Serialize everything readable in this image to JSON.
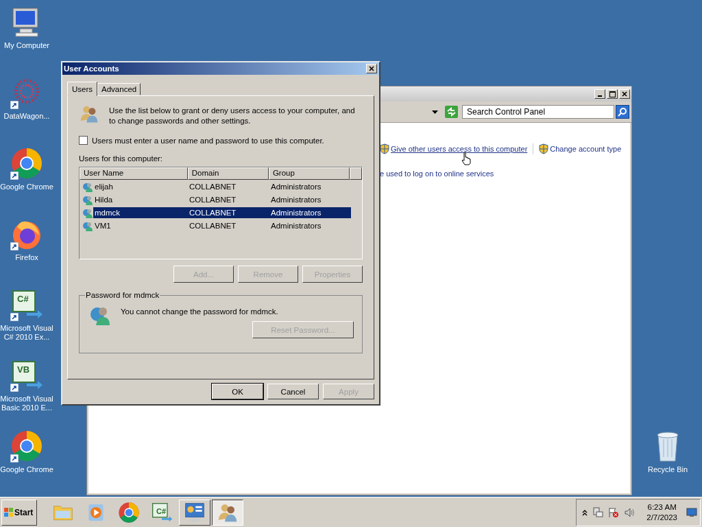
{
  "desktop_icons": [
    {
      "label": "My Computer",
      "kind": "computer",
      "shortcut": false
    },
    {
      "label": "DataWagon...",
      "kind": "dots",
      "shortcut": true
    },
    {
      "label": "Google Chrome",
      "kind": "chrome",
      "shortcut": true
    },
    {
      "label": "Firefox",
      "kind": "firefox",
      "shortcut": true
    },
    {
      "label": "Microsoft Visual C# 2010 Ex...",
      "kind": "studio",
      "badge": "C#",
      "shortcut": true
    },
    {
      "label": "Microsoft Visual Basic 2010 E...",
      "kind": "studio",
      "badge": "VB",
      "shortcut": true
    },
    {
      "label": "Google Chrome",
      "kind": "chrome",
      "shortcut": true
    }
  ],
  "recycle_bin": {
    "label": "Recycle Bin"
  },
  "control_panel": {
    "search": {
      "placeholder": "Search Control Panel"
    },
    "links": [
      {
        "label": "Give other users access to this computer",
        "hovered": true
      },
      {
        "label": "Change account type",
        "hovered": false
      }
    ],
    "partial_text": "e used to log on to online services"
  },
  "dialog": {
    "title": "User Accounts",
    "tabs": [
      {
        "label": "Users",
        "selected": true
      },
      {
        "label": "Advanced",
        "selected": false
      }
    ],
    "intro": "Use the list below to grant or deny users access to your computer, and to change passwords and other settings.",
    "require_password": {
      "label": "Users must enter a user name and password to use this computer.",
      "checked": false
    },
    "list_label": "Users for this computer:",
    "columns": [
      "User Name",
      "Domain",
      "Group"
    ],
    "rows": [
      {
        "cells": [
          "elijah",
          "COLLABNET",
          "Administrators"
        ],
        "selected": false
      },
      {
        "cells": [
          "Hilda",
          "COLLABNET",
          "Administrators"
        ],
        "selected": false
      },
      {
        "cells": [
          "mdmck",
          "COLLABNET",
          "Administrators"
        ],
        "selected": true
      },
      {
        "cells": [
          "VM1",
          "COLLABNET",
          "Administrators"
        ],
        "selected": false
      }
    ],
    "list_buttons": [
      {
        "label": "Add...",
        "disabled": true
      },
      {
        "label": "Remove",
        "disabled": true
      },
      {
        "label": "Properties",
        "disabled": true
      }
    ],
    "password_group": {
      "title": "Password for mdmck",
      "message": "You cannot change the password for mdmck.",
      "button": {
        "label": "Reset Password...",
        "disabled": true
      }
    },
    "buttons": [
      {
        "label": "OK",
        "disabled": false,
        "default": true
      },
      {
        "label": "Cancel",
        "disabled": false,
        "default": false
      },
      {
        "label": "Apply",
        "disabled": true,
        "default": false
      }
    ]
  },
  "taskbar": {
    "start": "Start",
    "apps": [
      {
        "kind": "folder",
        "open": false,
        "selected": false
      },
      {
        "kind": "media",
        "open": false,
        "selected": false
      },
      {
        "kind": "chrome",
        "open": false,
        "selected": false
      },
      {
        "kind": "studio",
        "badge": "C#",
        "open": false,
        "selected": false
      },
      {
        "kind": "panel",
        "open": true,
        "selected": false
      },
      {
        "kind": "users",
        "open": true,
        "selected": true
      }
    ],
    "time": "6:23 AM",
    "date": "2/7/2023"
  }
}
